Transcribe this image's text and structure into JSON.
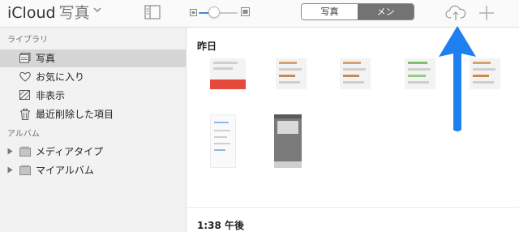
{
  "toolbar": {
    "app_name": "iCloud",
    "section_name": "写真",
    "segments": [
      {
        "label": "写真",
        "active": false
      },
      {
        "label": "メン",
        "active": true
      }
    ],
    "zoom_level": 0.35
  },
  "sidebar": {
    "library_header": "ライブラリ",
    "library_items": [
      {
        "label": "写真",
        "icon": "photos-icon",
        "selected": true
      },
      {
        "label": "お気に入り",
        "icon": "heart-icon",
        "selected": false
      },
      {
        "label": "非表示",
        "icon": "hidden-icon",
        "selected": false
      },
      {
        "label": "最近削除した項目",
        "icon": "trash-icon",
        "selected": false
      }
    ],
    "albums_header": "アルバム",
    "album_items": [
      {
        "label": "メディアタイプ",
        "icon": "folder-icon"
      },
      {
        "label": "マイアルバム",
        "icon": "folder-icon"
      }
    ]
  },
  "main": {
    "section_title": "昨日",
    "time_label": "1:38 午後"
  },
  "colors": {
    "arrow": "#1e7ff0",
    "segment_active": "#737373",
    "selected_row": "#d6d6d6"
  }
}
